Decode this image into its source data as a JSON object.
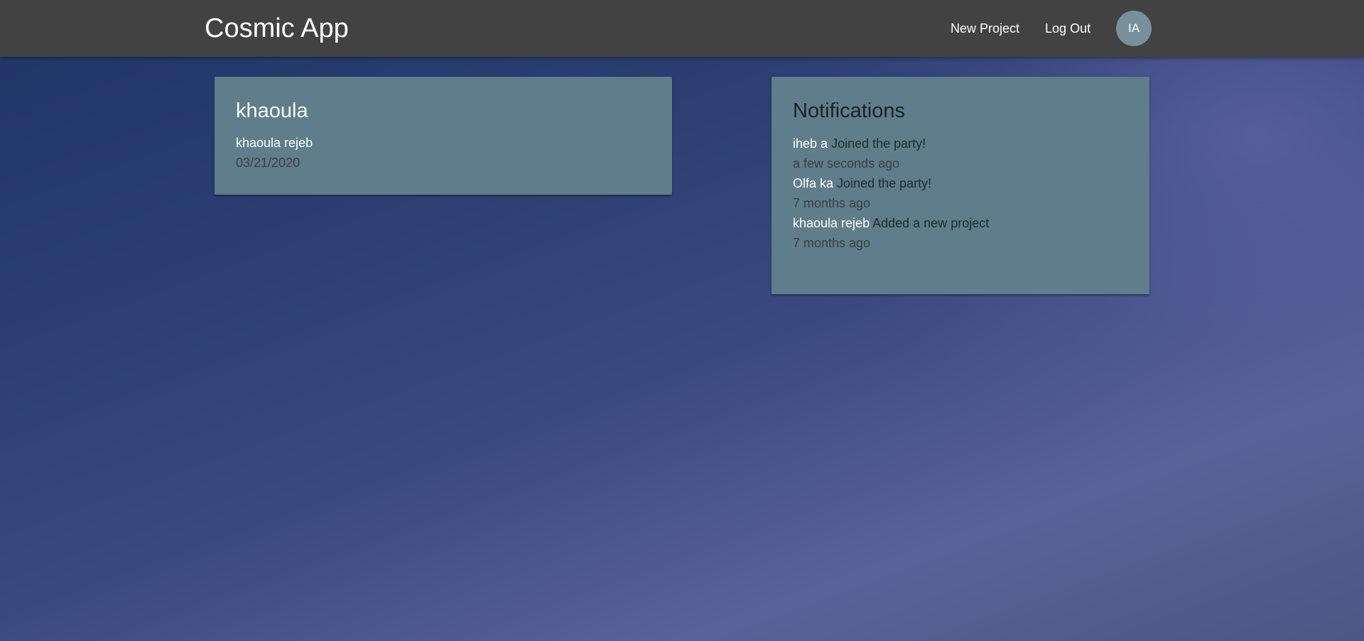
{
  "nav": {
    "brand": "Cosmic App",
    "links": [
      {
        "label": "New Project"
      },
      {
        "label": "Log Out"
      }
    ],
    "avatar_initials": "IA"
  },
  "profile": {
    "username": "khaoula",
    "full_name": "khaoula rejeb",
    "date": "03/21/2020"
  },
  "notifications": {
    "title": "Notifications",
    "items": [
      {
        "user": "iheb a",
        "action": "Joined the party!",
        "time": "a few seconds ago"
      },
      {
        "user": "Olfa ka",
        "action": "Joined the party!",
        "time": "7 months ago"
      },
      {
        "user": "khaoula rejeb",
        "action": "Added a new project",
        "time": "7 months ago"
      }
    ]
  },
  "colors": {
    "navbar": "#424242",
    "card": "#607d8b",
    "avatar": "#78909c"
  }
}
